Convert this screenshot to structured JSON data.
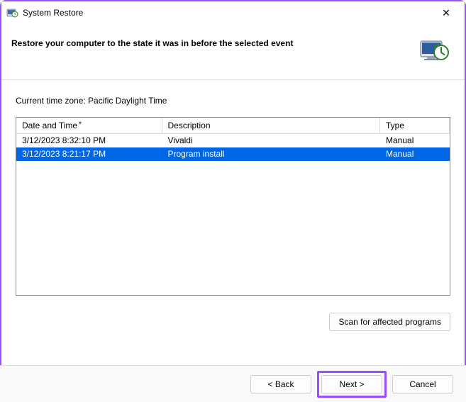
{
  "window": {
    "title": "System Restore",
    "close_symbol": "✕"
  },
  "header": {
    "headline": "Restore your computer to the state it was in before the selected event"
  },
  "timezone_label": "Current time zone: Pacific Daylight Time",
  "table": {
    "columns": {
      "date": "Date and Time",
      "desc": "Description",
      "type": "Type"
    },
    "rows": [
      {
        "date": "3/12/2023 8:32:10 PM",
        "desc": "Vivaldi",
        "type": "Manual",
        "selected": false
      },
      {
        "date": "3/12/2023 8:21:17 PM",
        "desc": "Program install",
        "type": "Manual",
        "selected": true
      }
    ]
  },
  "buttons": {
    "scan": "Scan for affected programs",
    "back": "< Back",
    "next": "Next >",
    "cancel": "Cancel"
  }
}
